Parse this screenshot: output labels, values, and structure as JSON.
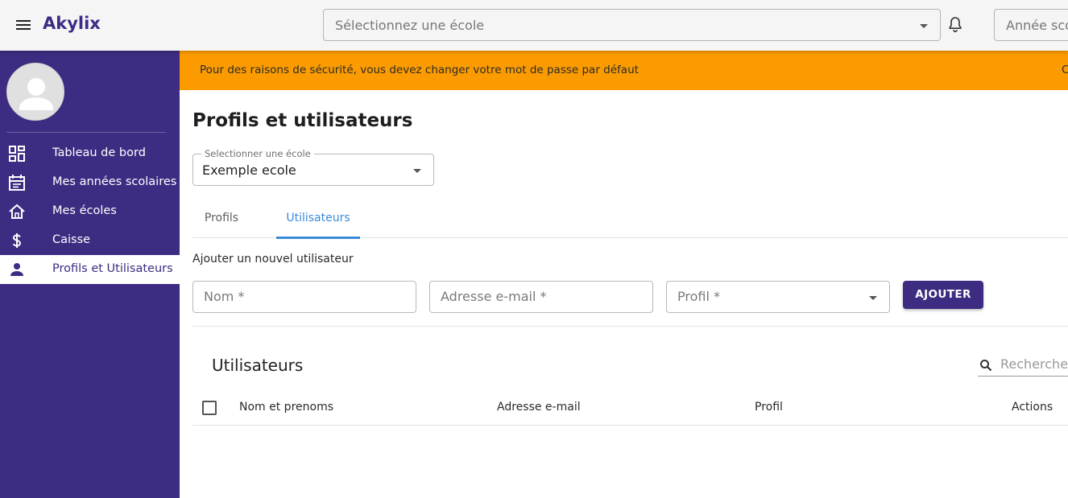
{
  "app": {
    "brand": "Akylix"
  },
  "topbar": {
    "school_placeholder": "Sélectionnez une école",
    "year_placeholder": "Année scolaire"
  },
  "sidebar": {
    "items": [
      {
        "label": "Tableau de bord",
        "icon": "dashboard-icon",
        "active": false
      },
      {
        "label": "Mes années scolaires",
        "icon": "calendar-icon",
        "active": false
      },
      {
        "label": "Mes écoles",
        "icon": "home-icon",
        "active": false
      },
      {
        "label": "Caisse",
        "icon": "dollar-icon",
        "active": false
      },
      {
        "label": "Profils et Utilisateurs",
        "icon": "person-icon",
        "active": true
      }
    ]
  },
  "banner": {
    "message": "Pour des raisons de sécurité, vous devez changer votre mot de passe par défaut",
    "edge_text": "C",
    "color": "#fb9b00"
  },
  "main": {
    "title": "Profils et utilisateurs",
    "school_select": {
      "label": "Selectionner une école",
      "value": "Exemple ecole"
    },
    "tabs": [
      {
        "label": "Profils",
        "active": false
      },
      {
        "label": "Utilisateurs",
        "active": true
      }
    ],
    "add_user": {
      "label": "Ajouter un nouvel utilisateur",
      "name_placeholder": "Nom *",
      "email_placeholder": "Adresse e-mail *",
      "profile_placeholder": "Profil *",
      "submit": "AJOUTER"
    },
    "users": {
      "title": "Utilisateurs",
      "search_placeholder": "Rechercher",
      "columns": [
        "Nom et prenoms",
        "Adresse e-mail",
        "Profil",
        "Actions"
      ],
      "rows": []
    }
  },
  "colors": {
    "primary": "#3d2c82",
    "accent": "#3b8ad8",
    "warning": "#fb9b00"
  }
}
